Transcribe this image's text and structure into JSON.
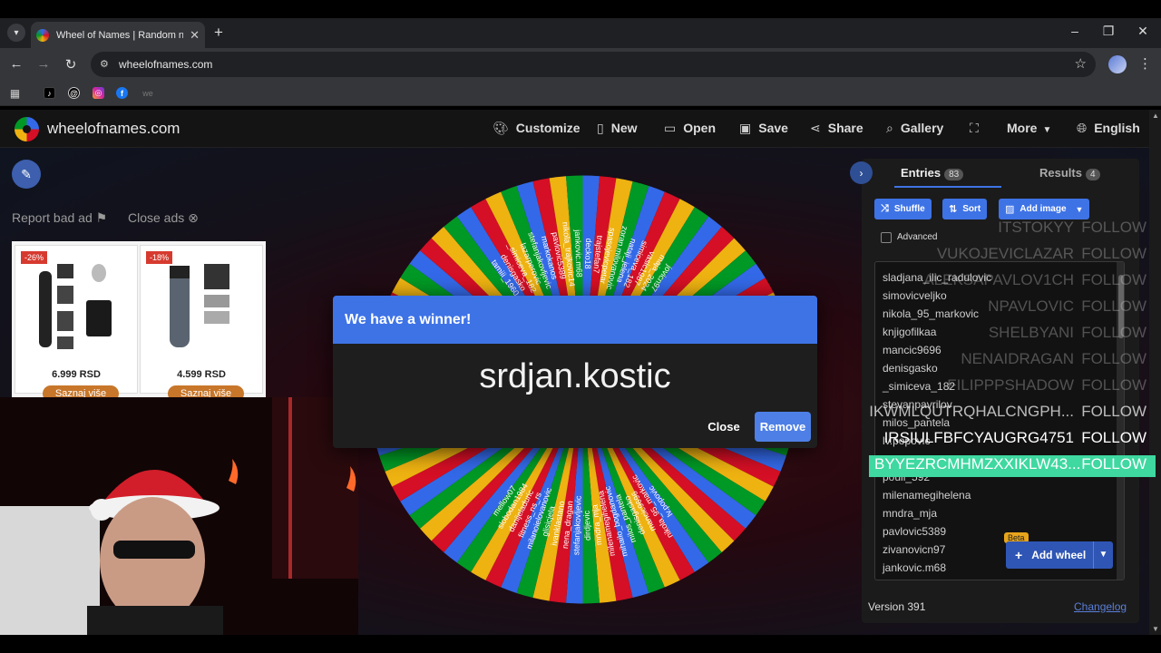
{
  "browser": {
    "tab_title": "Wheel of Names | Random nan",
    "url": "wheelofnames.com",
    "bookmark_last": "we"
  },
  "app": {
    "brand": "wheelofnames.com",
    "menu": {
      "customize": "Customize",
      "new": "New",
      "open": "Open",
      "save": "Save",
      "share": "Share",
      "gallery": "Gallery",
      "more": "More",
      "language": "English"
    },
    "report_bad_ad": "Report bad ad",
    "close_ads": "Close ads",
    "ads": [
      {
        "discount": "-26%",
        "price": "6.999 RSD",
        "button": "Saznaj više"
      },
      {
        "discount": "-18%",
        "price": "4.599 RSD",
        "button": "Saznaj više"
      }
    ]
  },
  "modal": {
    "title": "We have a winner!",
    "winner": "srdjan.kostic",
    "close": "Close",
    "remove": "Remove"
  },
  "panel": {
    "entries_tab": "Entries",
    "entries_count": "83",
    "results_tab": "Results",
    "results_count": "4",
    "shuffle": "Shuffle",
    "sort": "Sort",
    "add_image": "Add image",
    "advanced": "Advanced",
    "entries": [
      "sladjana_ilic_radulovic",
      "simovicveljko",
      "nikola_95_markovic",
      "knjigofilkaa",
      "mancic9696",
      "denisgasko",
      "_simiceva_182",
      "stevanpavrilov",
      "milos_pantela",
      "lv.popovic",
      "",
      "pouii_592",
      "milenamegihelena",
      "mndra_mja",
      "pavlovic5389",
      "zivanovicn97",
      "jankovic.m68"
    ],
    "beta": "Beta",
    "add_wheel": "Add wheel",
    "version": "Version 391",
    "changelog": "Changelog"
  },
  "overlay": {
    "follow_label": "FOLLOW",
    "rows": [
      {
        "name": "ITSTOKYY",
        "style": "faint"
      },
      {
        "name": "VUKOJEVICLAZAR",
        "style": "faint"
      },
      {
        "name": "ALEKSAPAVLOV1CH",
        "style": "faint"
      },
      {
        "name": "NPAVLOVIC",
        "style": "faint"
      },
      {
        "name": "SHELBYANI",
        "style": "faint"
      },
      {
        "name": "NENAIDRAGAN",
        "style": "faint"
      },
      {
        "name": "FILIPPPSHADOW",
        "style": "faint"
      },
      {
        "name": "IKWMLQUTRQHALCNGPH...",
        "style": "mid"
      },
      {
        "name": "IRSIULFBFCYAUGRG4751",
        "style": "bright"
      },
      {
        "name": "BYYEZRCMHMZXXIKLW43...",
        "style": "highlight"
      }
    ]
  },
  "wheel": {
    "segment_colors": [
      "#3369e8",
      "#d50f25",
      "#eeb211",
      "#009925"
    ],
    "top_labels": [
      "tamiii_1960",
      "denisgasko",
      "_simiceva_182",
      "lazarperovic",
      "stefanjakovljevic",
      "markokanos",
      "pavlovic5389",
      "nikola_trajkovic14",
      "jankovic.m68",
      "decko18",
      "trajstefan7",
      "spasojevicpetar",
      "zoran.milovanovic",
      "nataji_jelena",
      "simiceva_182",
      "vasic1987",
      "maja_2024",
      "jovicn97"
    ],
    "bottom_labels": [
      "lv.popovic",
      "nikola_95_markovic",
      "mancic9696",
      "denisgasko",
      "milos_pantela",
      "mihailo_bogdanovic",
      "milenamegihelena",
      "mndra_mja",
      "dirdjevic",
      "stefanjakovljevic",
      "nena_dragan",
      "ivanklastano",
      "glisicjela",
      "milanoielovanovic",
      "fitness_ns_rs",
      "danijeladuric",
      "slobodan1984",
      "mellow07"
    ]
  }
}
